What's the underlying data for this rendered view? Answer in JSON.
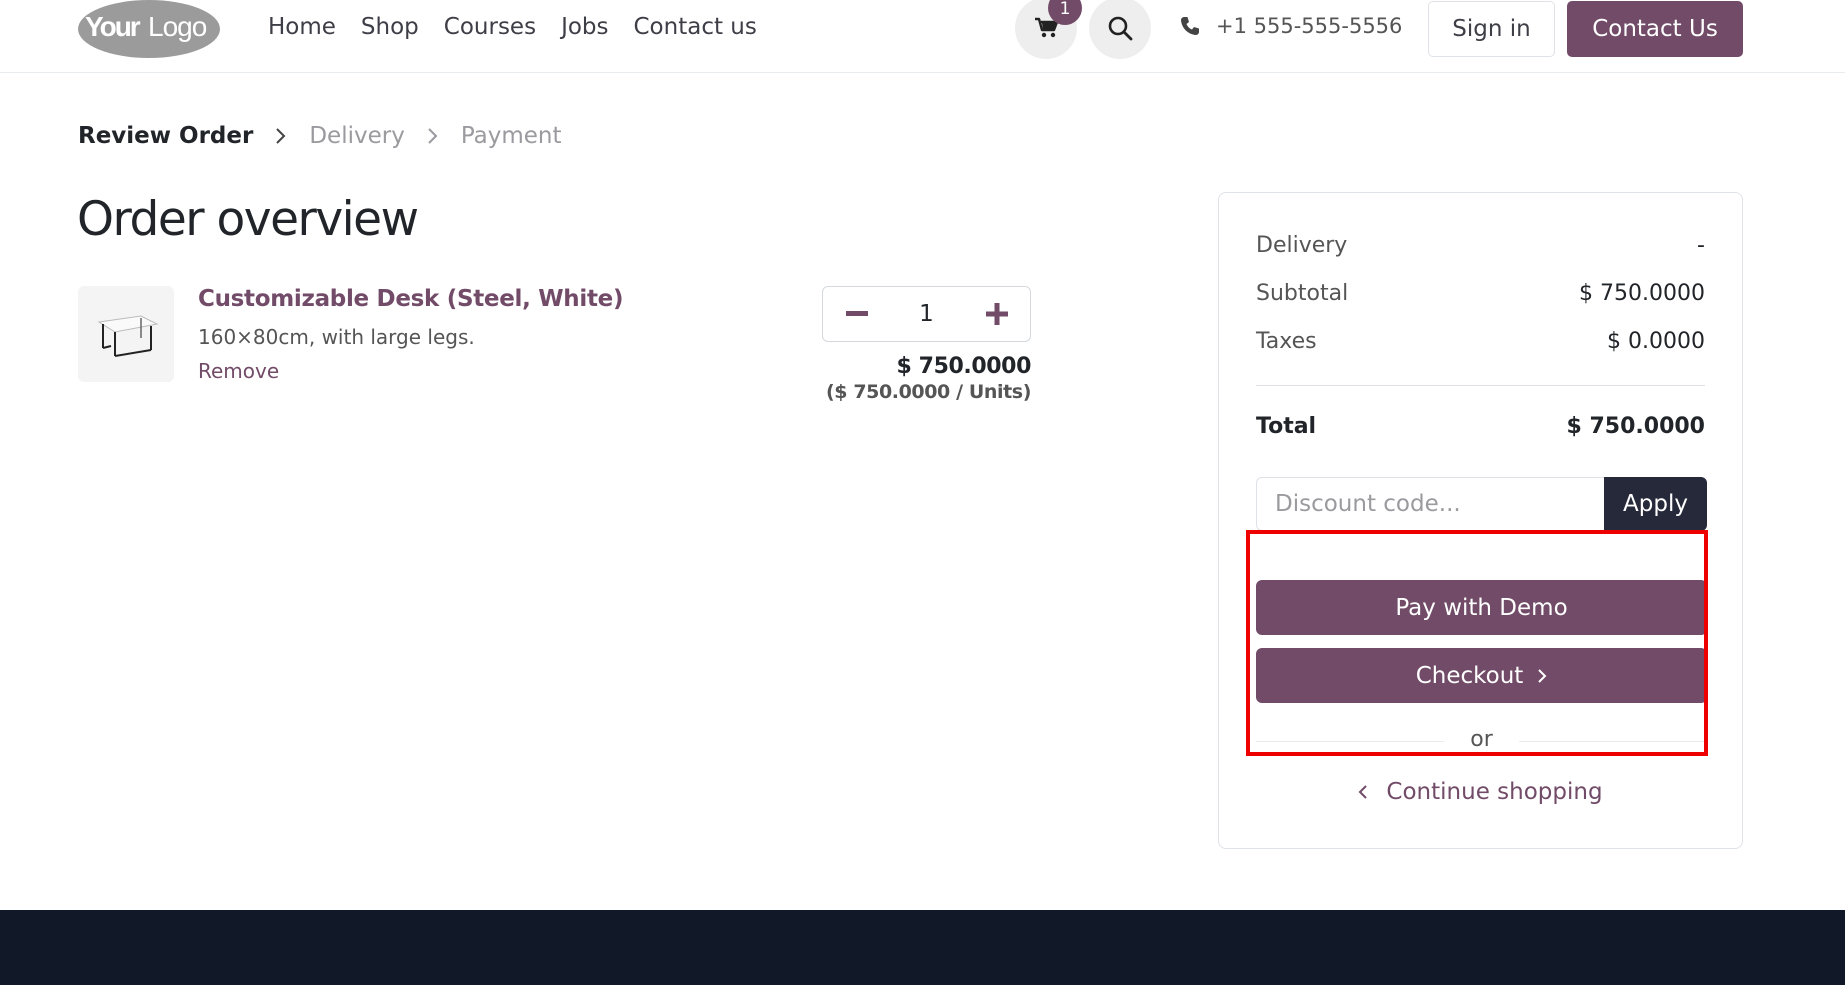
{
  "header": {
    "logo_text": "YourLogo",
    "nav": [
      "Home",
      "Shop",
      "Courses",
      "Jobs",
      "Contact us"
    ],
    "cart_count": "1",
    "phone": "+1 555-555-5556",
    "sign_in_label": "Sign in",
    "contact_label": "Contact Us"
  },
  "steps": {
    "review": "Review Order",
    "delivery": "Delivery",
    "payment": "Payment"
  },
  "order": {
    "title": "Order overview",
    "product_name": "Customizable Desk (Steel, White)",
    "product_desc": "160×80cm, with large legs.",
    "remove_label": "Remove",
    "quantity": "1",
    "price": "$ 750.0000",
    "unit_price": "($ 750.0000 / Units)"
  },
  "summary": {
    "delivery_label": "Delivery",
    "delivery_value": "-",
    "subtotal_label": "Subtotal",
    "subtotal_value": "$ 750.0000",
    "taxes_label": "Taxes",
    "taxes_value": "$ 0.0000",
    "total_label": "Total",
    "total_value": "$ 750.0000",
    "discount_placeholder": "Discount code...",
    "apply_label": "Apply",
    "pay_demo_label": "Pay with Demo",
    "checkout_label": "Checkout",
    "or_label": "or",
    "continue_label": "Continue shopping"
  },
  "colors": {
    "brand": "#714b67",
    "dark_button": "#262939",
    "footer": "#111827",
    "highlight": "#ee0000"
  }
}
